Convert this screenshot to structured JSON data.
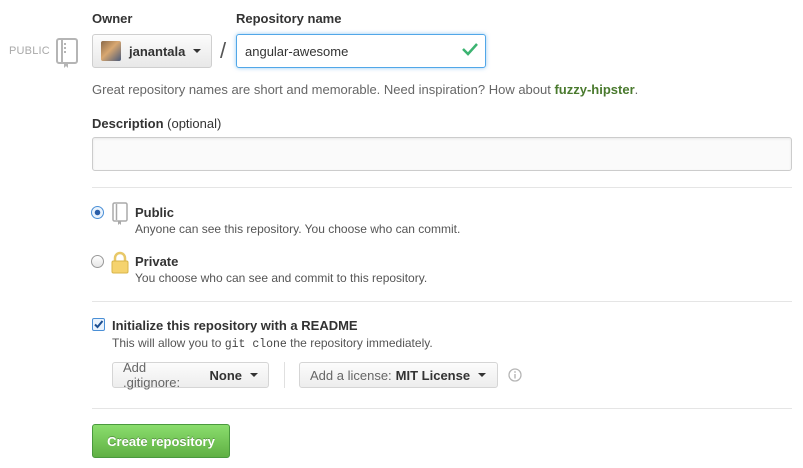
{
  "visibility_badge": {
    "label": "PUBLIC",
    "icon": "repo-book-icon"
  },
  "owner": {
    "label": "Owner",
    "username": "janantala",
    "separator": "/"
  },
  "repo_name": {
    "label": "Repository name",
    "value": "angular-awesome",
    "status_icon": "check-icon",
    "status_color": "#3cb371"
  },
  "hint": {
    "text": "Great repository names are short and memorable. Need inspiration? How about ",
    "suggestion": "fuzzy-hipster",
    "suffix": "."
  },
  "description": {
    "label": "Description",
    "optional": "(optional)",
    "value": "",
    "placeholder": ""
  },
  "visibility": {
    "public": {
      "title": "Public",
      "desc": "Anyone can see this repository. You choose who can commit.",
      "checked": true
    },
    "private": {
      "title": "Private",
      "desc": "You choose who can see and commit to this repository.",
      "checked": false
    }
  },
  "readme": {
    "title": "Initialize this repository with a README",
    "desc_before": "This will allow you to ",
    "desc_code": "git clone",
    "desc_after": " the repository immediately.",
    "checked": true
  },
  "gitignore": {
    "label": "Add .gitignore:",
    "value": "None"
  },
  "license": {
    "label": "Add a license:",
    "value": "MIT License"
  },
  "create_button": {
    "label": "Create repository",
    "color": "#60b044"
  }
}
